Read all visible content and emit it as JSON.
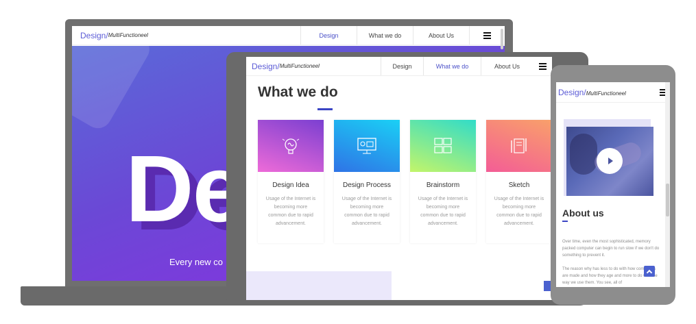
{
  "brand": {
    "main": "Design/",
    "tagline": "MultiFunctioneel"
  },
  "laptop": {
    "nav": [
      {
        "label": "Design",
        "active": true
      },
      {
        "label": "What we do",
        "active": false
      },
      {
        "label": "About Us",
        "active": false
      }
    ],
    "hero_word": "Des",
    "hero_subtitle": "Every new co"
  },
  "tablet": {
    "nav": [
      {
        "label": "Design",
        "active": false
      },
      {
        "label": "What we do",
        "active": true
      },
      {
        "label": "About Us",
        "active": false
      }
    ],
    "section_title": "What we do",
    "cards": [
      {
        "title": "Design Idea",
        "text": "Usage of the Internet is becoming more common due to rapid advancement.",
        "icon": "brain-bulb-icon",
        "gradient": [
          "#7b3fd1",
          "#ee6bd8"
        ]
      },
      {
        "title": "Design Process",
        "text": "Usage of the Internet is becoming more common due to rapid advancement.",
        "icon": "monitor-design-icon",
        "gradient": [
          "#1ab5f0",
          "#2f83e6"
        ]
      },
      {
        "title": "Brainstorm",
        "text": "Usage of the Internet is becoming more common due to rapid advancement.",
        "icon": "chat-bubbles-icon",
        "gradient": [
          "#3fe2c4",
          "#b7f06a"
        ]
      },
      {
        "title": "Sketch",
        "text": "Usage of the Internet is becoming more common due to rapid advancement.",
        "icon": "sketch-tools-icon",
        "gradient": [
          "#f26c92",
          "#fda06c"
        ]
      }
    ]
  },
  "phone": {
    "section_title": "About us",
    "paragraph1": "Over time, even the most sophisticated, memory packed computer can begin to run slow if we don't do something to prevent it.",
    "paragraph2": "The reason why has less to do with how computers are made and how they age and more to do with the way we use them. You see, all of"
  },
  "colors": {
    "accent": "#4a50c8",
    "hero_start": "#5a6ad8",
    "hero_end": "#8a2fe0"
  }
}
